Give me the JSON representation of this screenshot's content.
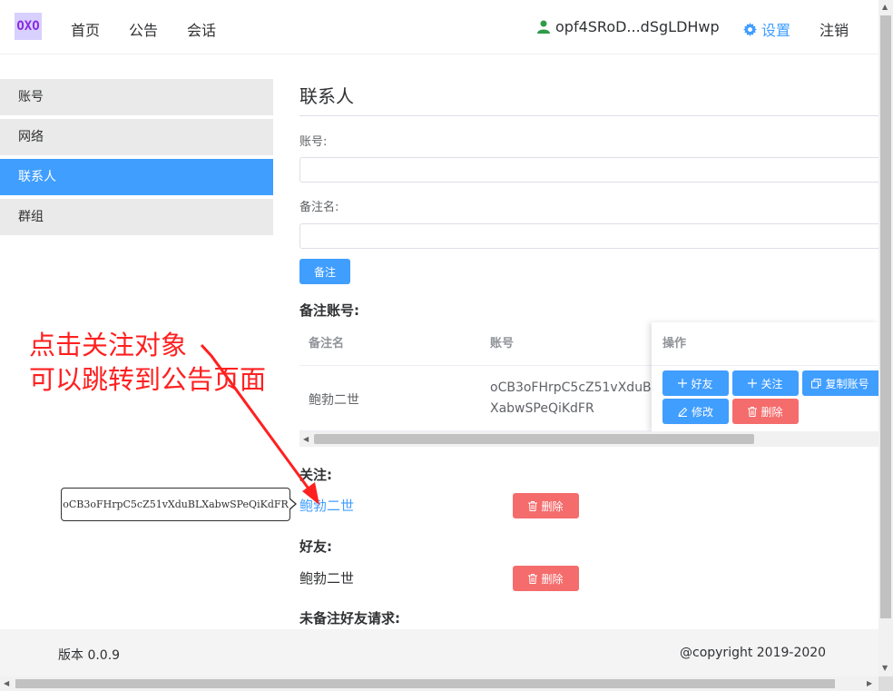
{
  "header": {
    "logo": "OXO",
    "nav": [
      "首页",
      "公告",
      "会话"
    ],
    "user_name": "opf4SRoD...dSgLDHwp",
    "settings_label": "设置",
    "logout_label": "注销"
  },
  "sidebar": {
    "items": [
      "账号",
      "网络",
      "联系人",
      "群组"
    ],
    "active": "联系人"
  },
  "main": {
    "title": "联系人",
    "account_label": "账号:",
    "account_value": "",
    "remark_label": "备注名:",
    "remark_value": "",
    "remark_button": "备注",
    "remarked_section": "备注账号:",
    "table": {
      "headers": [
        "备注名",
        "账号",
        "操作"
      ],
      "rows": [
        {
          "name": "鲍勃二世",
          "account_line1": "oCB3oFHrpC5cZ51vXduBL",
          "account_line2": "XabwSPeQiKdFR"
        }
      ],
      "actions": {
        "friend": "好友",
        "follow": "关注",
        "copy": "复制账号",
        "edit": "修改",
        "delete": "删除"
      }
    },
    "follow_section": "关注:",
    "follow_name": "鲍勃二世",
    "friends_section": "好友:",
    "friend_name": "鲍勃二世",
    "delete_label": "删除",
    "pending_section": "未备注好友请求:"
  },
  "tooltip": "oCB3oFHrpC5cZ51vXduBLXabwSPeQiKdFR",
  "annotation": {
    "line1": "点击关注对象",
    "line2": "可以跳转到公告页面",
    "color": "#ff2020"
  },
  "footer": {
    "version": "版本 0.0.9",
    "copyright": "@copyright 2019-2020"
  }
}
